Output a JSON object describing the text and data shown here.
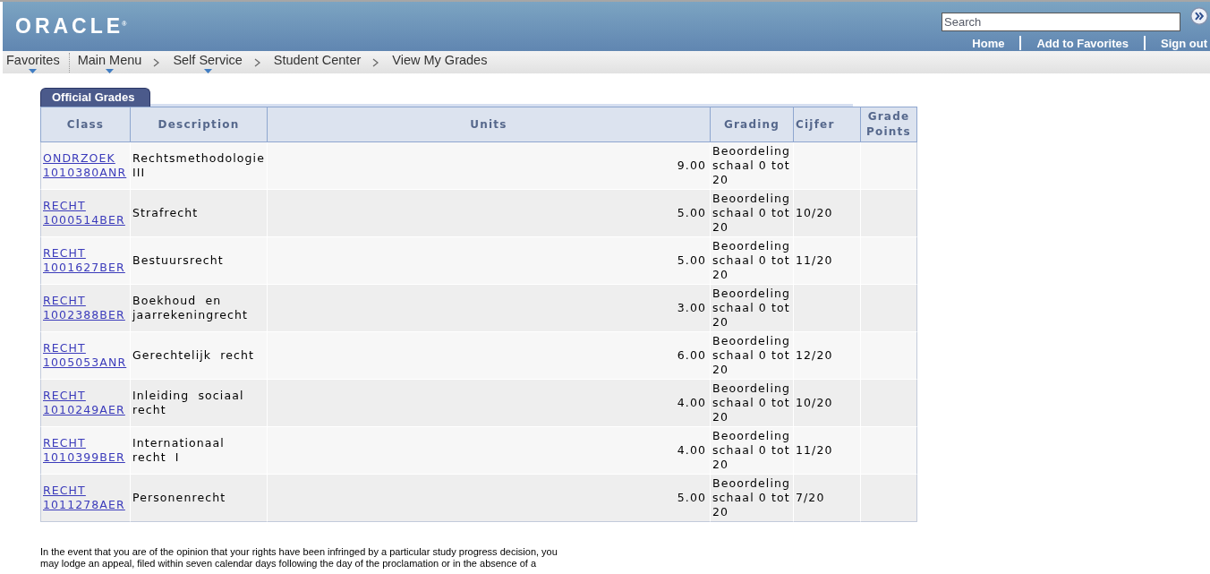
{
  "header": {
    "logo": "ORACLE$^{®}$",
    "search": {
      "placeholder": "Search"
    },
    "links": [
      "Home",
      "Add to Favorites",
      "Sign out"
    ]
  },
  "nav": {
    "favorites": {
      "label": "Favorites",
      "dropdown": true
    },
    "breadcrumbs": [
      {
        "label": "Main Menu",
        "dropdown": true
      },
      {
        "label": "Self Service",
        "dropdown": true
      },
      {
        "label": "Student Center",
        "dropdown": false
      },
      {
        "label": "View My Grades",
        "dropdown": false
      }
    ]
  },
  "tabs": [
    {
      "label": "Official Grades",
      "selected": true
    }
  ],
  "table": {
    "columns": [
      "Class",
      "Description",
      "Units",
      "Grading",
      "Cijfer",
      "Grade Points"
    ],
    "rows": [
      {
        "class": "ONDRZOEK 1010380ANR",
        "description": "Rechtsmethodologie III",
        "units": "9.00",
        "grading": "Beoordeling schaal 0 tot 20"
      },
      {
        "class": "RECHT 1000514BER",
        "description": "Strafrecht",
        "units": "5.00",
        "grading": "Beoordeling schaal 0 tot 20",
        "cijfer": "10/20"
      },
      {
        "class": "RECHT 1001627BER",
        "description": "Bestuursrecht",
        "units": "5.00",
        "grading": "Beoordeling schaal 0 tot 20",
        "cijfer": "11/20"
      },
      {
        "class": "RECHT 1002388BER",
        "description": "Boekhoud en jaarrekeningrecht",
        "units": "3.00",
        "grading": "Beoordeling schaal 0 tot 20"
      },
      {
        "class": "RECHT 1005053ANR",
        "description": "Gerechtelijk recht",
        "units": "6.00",
        "grading": "Beoordeling schaal 0 tot 20",
        "cijfer": "12/20"
      },
      {
        "class": "RECHT 1010249AER",
        "description": "Inleiding sociaal recht",
        "units": "4.00",
        "grading": "Beoordeling schaal 0 tot 20",
        "cijfer": "10/20"
      },
      {
        "class": "RECHT 1010399BER",
        "description": "Internationaal recht I",
        "units": "4.00",
        "grading": "Beoordeling schaal 0 tot 20",
        "cijfer": "11/20"
      },
      {
        "class": "RECHT 1011278AER",
        "description": "Personenrecht",
        "units": "5.00",
        "grading": "Beoordeling schaal 0 tot 20",
        "cijfer": "7/20"
      }
    ]
  },
  "notice": "In the event that you are of the opinion that your rights have been infringed by a particular study progress decision, you may lodge an appeal, filed within seven calendar days following the day of the proclamation or in the absence of a"
}
